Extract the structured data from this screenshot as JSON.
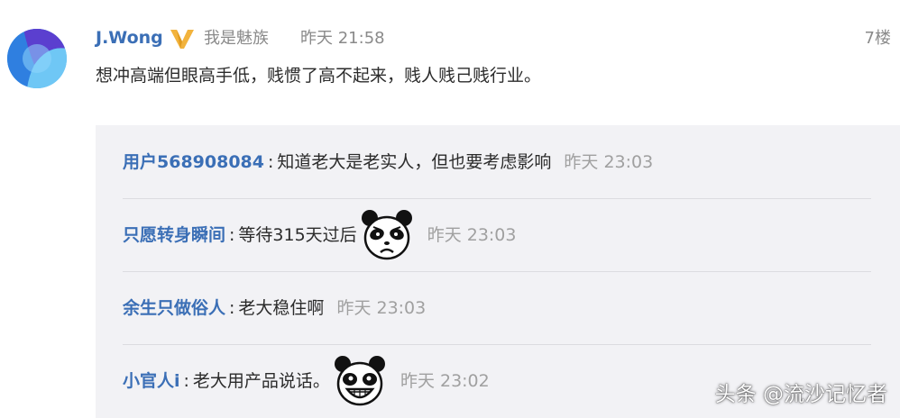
{
  "post": {
    "author": "J.Wong",
    "source": "我是魅族",
    "time": "昨天 21:58",
    "ago": "7楼",
    "text": "想冲高端但眼高手低，贱惯了高不起来，贱人贱己贱行业。"
  },
  "comments": [
    {
      "user": "用户568908084",
      "sep": ":",
      "text": "知道老大是老实人，但也要考虑影响",
      "time": "昨天 23:03",
      "emoji": null
    },
    {
      "user": "只愿转身瞬间",
      "sep": ":",
      "text": "等待315天过后",
      "time": "昨天 23:03",
      "emoji": "sad-panda-icon"
    },
    {
      "user": "余生只做俗人",
      "sep": ":",
      "text": "老大稳住啊",
      "time": "昨天 23:03",
      "emoji": null
    },
    {
      "user": "小官人i",
      "sep": ":",
      "text": "老大用产品说话。",
      "time": "昨天 23:02",
      "emoji": "grinning-panda-icon"
    }
  ],
  "watermark": "头条 @流沙记忆者",
  "colors": {
    "username": "#3b6fb6",
    "body_text": "#2b2b2b",
    "meta_text": "#8a8a8a",
    "panel_bg": "#f2f2f5",
    "vip_badge": "#f2b33d"
  }
}
